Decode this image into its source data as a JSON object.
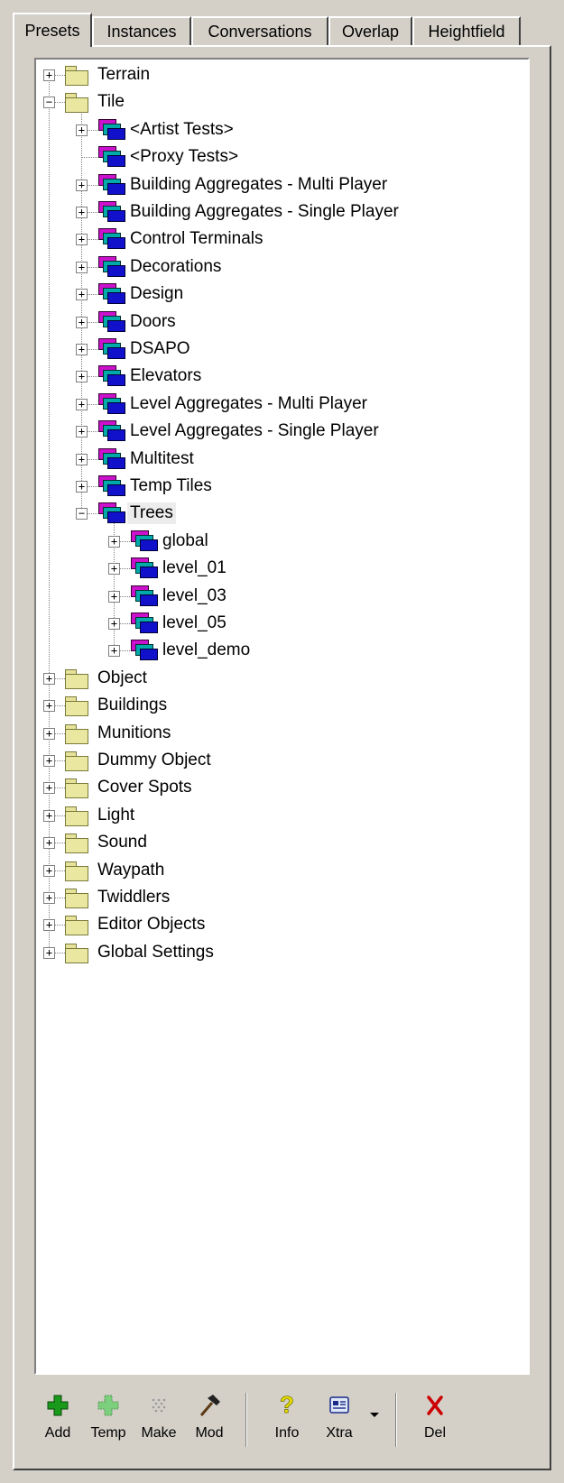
{
  "tabs": [
    {
      "label": "Presets",
      "active": true
    },
    {
      "label": "Instances",
      "active": false
    },
    {
      "label": "Conversations",
      "active": false
    },
    {
      "label": "Overlap",
      "active": false
    },
    {
      "label": "Heightfield",
      "active": false
    }
  ],
  "tree": [
    {
      "label": "Terrain",
      "depth": 0,
      "icon": "folder-icon",
      "expander": "+"
    },
    {
      "label": "Tile",
      "depth": 0,
      "icon": "folder-icon",
      "expander": "-"
    },
    {
      "label": "<Artist Tests>",
      "depth": 1,
      "icon": "tile-group-icon",
      "expander": "+"
    },
    {
      "label": "<Proxy Tests>",
      "depth": 1,
      "icon": "tile-group-icon",
      "expander": ""
    },
    {
      "label": "Building Aggregates - Multi Player",
      "depth": 1,
      "icon": "tile-group-icon",
      "expander": "+"
    },
    {
      "label": "Building Aggregates - Single Player",
      "depth": 1,
      "icon": "tile-group-icon",
      "expander": "+"
    },
    {
      "label": "Control Terminals",
      "depth": 1,
      "icon": "tile-group-icon",
      "expander": "+"
    },
    {
      "label": "Decorations",
      "depth": 1,
      "icon": "tile-group-icon",
      "expander": "+"
    },
    {
      "label": "Design",
      "depth": 1,
      "icon": "tile-group-icon",
      "expander": "+"
    },
    {
      "label": "Doors",
      "depth": 1,
      "icon": "tile-group-icon",
      "expander": "+"
    },
    {
      "label": "DSAPO",
      "depth": 1,
      "icon": "tile-group-icon",
      "expander": "+"
    },
    {
      "label": "Elevators",
      "depth": 1,
      "icon": "tile-group-icon",
      "expander": "+"
    },
    {
      "label": "Level Aggregates - Multi Player",
      "depth": 1,
      "icon": "tile-group-icon",
      "expander": "+"
    },
    {
      "label": "Level Aggregates - Single Player",
      "depth": 1,
      "icon": "tile-group-icon",
      "expander": "+"
    },
    {
      "label": "Multitest",
      "depth": 1,
      "icon": "tile-group-icon",
      "expander": "+"
    },
    {
      "label": "Temp Tiles",
      "depth": 1,
      "icon": "tile-group-icon",
      "expander": "+"
    },
    {
      "label": "Trees",
      "depth": 1,
      "icon": "tile-group-icon",
      "expander": "-",
      "selected": true
    },
    {
      "label": "global",
      "depth": 2,
      "icon": "tile-group-icon",
      "expander": "+"
    },
    {
      "label": "level_01",
      "depth": 2,
      "icon": "tile-group-icon",
      "expander": "+"
    },
    {
      "label": "level_03",
      "depth": 2,
      "icon": "tile-group-icon",
      "expander": "+"
    },
    {
      "label": "level_05",
      "depth": 2,
      "icon": "tile-group-icon",
      "expander": "+"
    },
    {
      "label": "level_demo",
      "depth": 2,
      "icon": "tile-group-icon",
      "expander": "+"
    },
    {
      "label": "Object",
      "depth": 0,
      "icon": "folder-icon",
      "expander": "+"
    },
    {
      "label": "Buildings",
      "depth": 0,
      "icon": "folder-icon",
      "expander": "+"
    },
    {
      "label": "Munitions",
      "depth": 0,
      "icon": "folder-icon",
      "expander": "+"
    },
    {
      "label": "Dummy Object",
      "depth": 0,
      "icon": "folder-icon",
      "expander": "+"
    },
    {
      "label": "Cover Spots",
      "depth": 0,
      "icon": "folder-icon",
      "expander": "+"
    },
    {
      "label": "Light",
      "depth": 0,
      "icon": "folder-icon",
      "expander": "+"
    },
    {
      "label": "Sound",
      "depth": 0,
      "icon": "folder-icon",
      "expander": "+"
    },
    {
      "label": "Waypath",
      "depth": 0,
      "icon": "folder-icon",
      "expander": "+"
    },
    {
      "label": "Twiddlers",
      "depth": 0,
      "icon": "folder-icon",
      "expander": "+"
    },
    {
      "label": "Editor Objects",
      "depth": 0,
      "icon": "folder-icon",
      "expander": "+"
    },
    {
      "label": "Global Settings",
      "depth": 0,
      "icon": "folder-icon",
      "expander": "+"
    }
  ],
  "toolbar": {
    "add": "Add",
    "temp": "Temp",
    "make": "Make",
    "mod": "Mod",
    "info": "Info",
    "xtra": "Xtra",
    "del": "Del"
  },
  "colors": {
    "window_bg": "#d4d0c8",
    "tree_bg": "#ffffff",
    "folder": "#eae8a0",
    "tile_magenta": "#cc11cc",
    "tile_teal": "#00aaaa",
    "tile_blue": "#1111cc",
    "add_green": "#1a9a1a",
    "del_red": "#cc0000",
    "info_yellow": "#e8e000"
  }
}
